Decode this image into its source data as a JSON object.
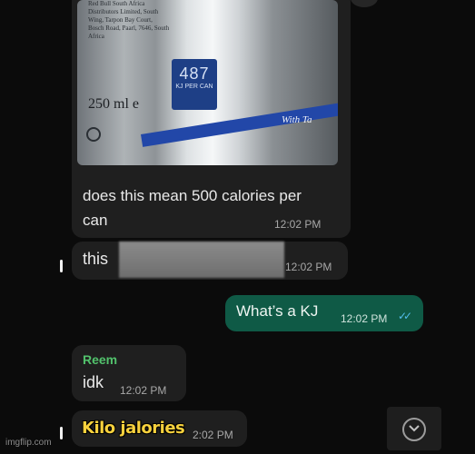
{
  "messages": [
    {
      "type": "image",
      "image_text": {
        "can_small_text": "Red Bull South Africa Distributors Limited, South Wing, Tarpon Bay Court, Bosch Road, Paarl, 7646, South Africa",
        "energy_value": "487",
        "energy_unit": "KJ PER CAN",
        "volume": "250 ml e",
        "with_text": "With Ta"
      },
      "caption": "does this mean 500 calories per can",
      "time": "12:02 PM"
    },
    {
      "type": "incoming",
      "text": "this",
      "time": "12:02 PM"
    },
    {
      "type": "outgoing",
      "text": "What’s a KJ",
      "time": "12:02 PM"
    },
    {
      "type": "incoming",
      "sender": "Reem",
      "text": "idk",
      "time": "12:02 PM"
    },
    {
      "type": "incoming",
      "time": "2:02 PM"
    }
  ],
  "overlay_caption": "Kilo jalories",
  "read_receipt": "✓✓",
  "scroll_icon": "chevron-down-icon",
  "watermark": "imgflip.com",
  "colors": {
    "incoming": "#1f1f1f",
    "outgoing": "#0f5a46",
    "sender_name": "#52c26c",
    "receipt": "#53bdeb",
    "overlay_text": "#f7d13d"
  }
}
